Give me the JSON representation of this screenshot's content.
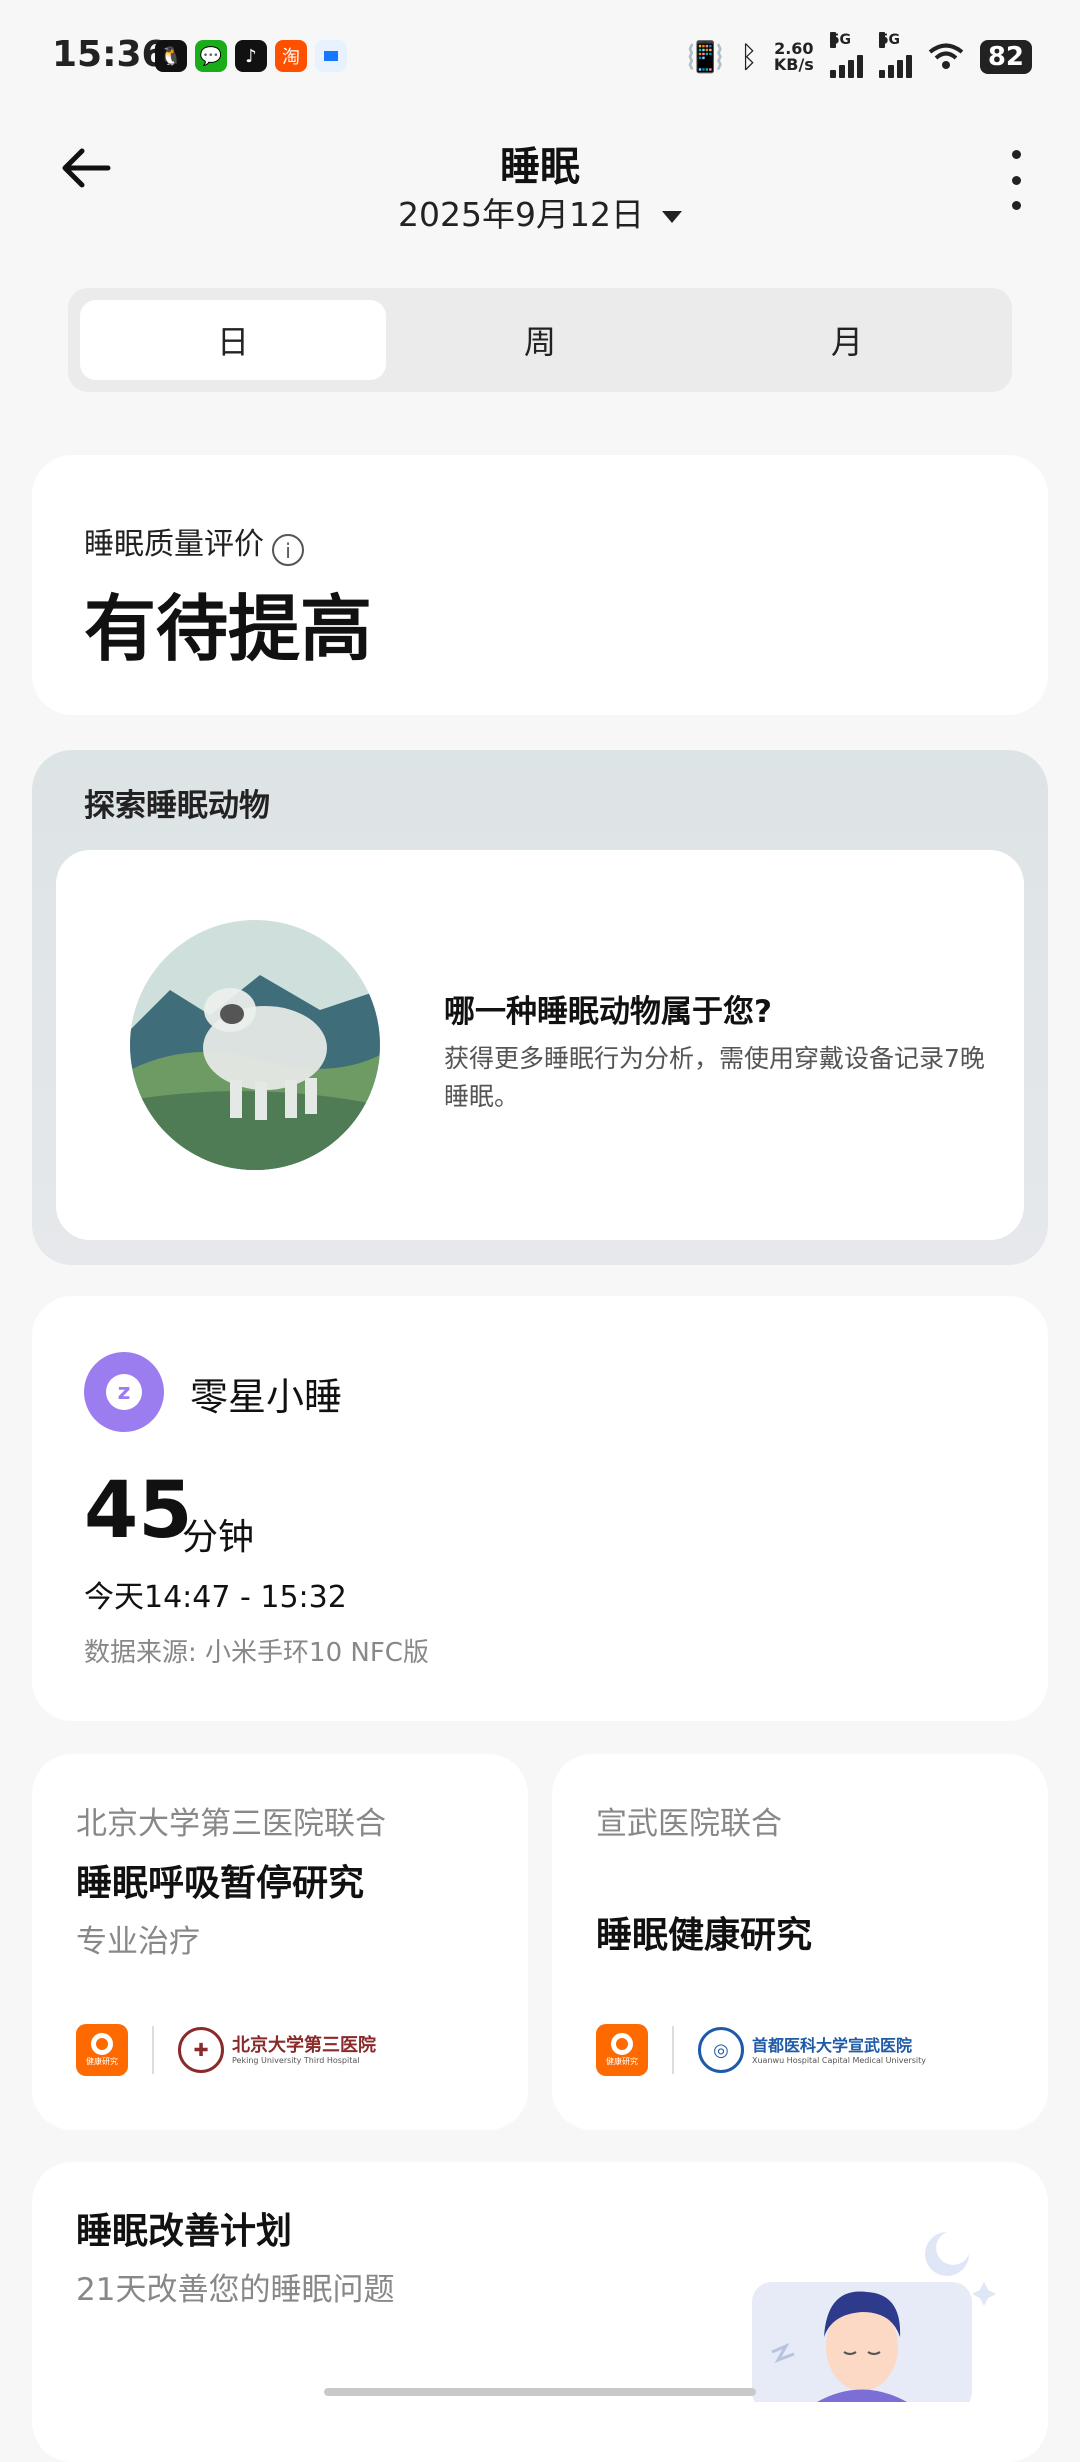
{
  "status_bar": {
    "time": "15:36",
    "net_speed_value": "2.60",
    "net_speed_unit": "KB/s",
    "signal1": "5G",
    "signal2": "5G",
    "battery": "82"
  },
  "header": {
    "title": "睡眠",
    "date": "2025年9月12日"
  },
  "tabs": [
    {
      "label": "日",
      "active": true
    },
    {
      "label": "周",
      "active": false
    },
    {
      "label": "月",
      "active": false
    }
  ],
  "quality": {
    "label": "睡眠质量评价",
    "value": "有待提高"
  },
  "explore": {
    "title": "探索睡眠动物",
    "question": "哪一种睡眠动物属于您?",
    "description": "获得更多睡眠行为分析，需使用穿戴设备记录7晚睡眠。"
  },
  "nap": {
    "title": "零星小睡",
    "duration": "45",
    "unit": "分钟",
    "range": "今天14:47 - 15:32",
    "source": "数据来源: 小米手环10 NFC版"
  },
  "studies": [
    {
      "subtitle": "北京大学第三医院联合",
      "title": "睡眠呼吸暂停研究",
      "tag": "专业治疗",
      "logo_caption": "健康研究",
      "hospital_name": "北京大学第三医院",
      "hospital_en": "Peking University Third Hospital"
    },
    {
      "subtitle": "宣武医院联合",
      "title": "睡眠健康研究",
      "logo_caption": "健康研究",
      "hospital_name": "首都医科大学宣武医院",
      "hospital_en": "Xuanwu Hospital Capital Medical University"
    }
  ],
  "plan": {
    "title": "睡眠改善计划",
    "subtitle": "21天改善您的睡眠问题"
  },
  "colors": {
    "accent_purple": "#9b7df0",
    "logo_orange": "#ff6a00"
  }
}
